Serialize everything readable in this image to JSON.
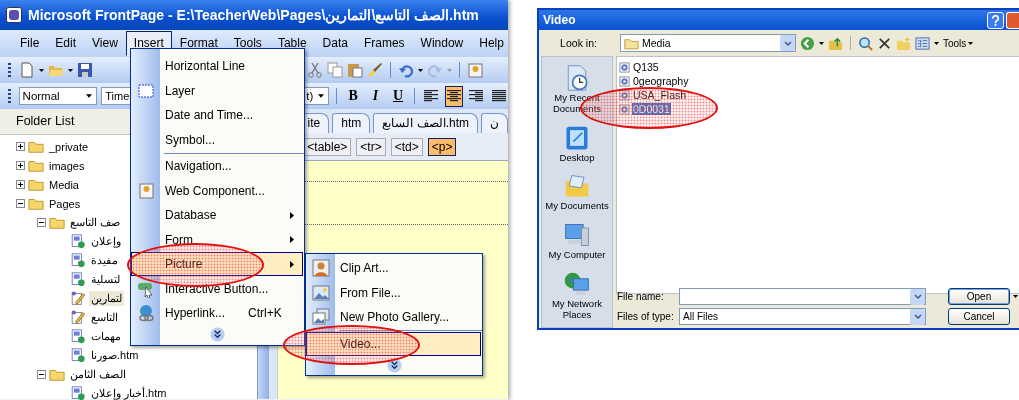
{
  "frontpage": {
    "title": "Microsoft FrontPage - E:\\TeacherWeb\\Pages\\الصف التاسع\\التمارين.htm",
    "menus": [
      {
        "label": "File",
        "selected": false
      },
      {
        "label": "Edit",
        "selected": false
      },
      {
        "label": "View",
        "selected": false
      },
      {
        "label": "Insert",
        "selected": true
      },
      {
        "label": "Format",
        "selected": false
      },
      {
        "label": "Tools",
        "selected": false
      },
      {
        "label": "Table",
        "selected": false
      },
      {
        "label": "Data",
        "selected": false
      },
      {
        "label": "Frames",
        "selected": false
      },
      {
        "label": "Window",
        "selected": false
      },
      {
        "label": "Help",
        "selected": false
      }
    ],
    "formatting": {
      "style": "Normal",
      "font": "Time",
      "size": "t)"
    },
    "text_buttons": [
      {
        "label": "B",
        "kind": "bold",
        "selected": false
      },
      {
        "label": "I",
        "kind": "italic",
        "selected": false
      },
      {
        "label": "U",
        "kind": "underline",
        "selected": false
      }
    ],
    "align_buttons": [
      {
        "kind": "left",
        "selected": false
      },
      {
        "kind": "center",
        "selected": true
      },
      {
        "kind": "right",
        "selected": false
      },
      {
        "kind": "justify",
        "selected": false
      }
    ],
    "folder_list": {
      "title": "Folder List",
      "items": [
        {
          "label": "_private",
          "kind": "folder",
          "expanded": false,
          "selected": false
        },
        {
          "label": "images",
          "kind": "folder",
          "expanded": false,
          "selected": false
        },
        {
          "label": "Media",
          "kind": "folder",
          "expanded": false,
          "selected": false
        },
        {
          "label": "Pages",
          "kind": "folder",
          "expanded": true,
          "selected": false,
          "children": [
            {
              "label": "صف التاسع",
              "kind": "folder",
              "expanded": true,
              "selected": false,
              "children": [
                {
                  "label": "وإعلان",
                  "kind": "page",
                  "selected": false
                },
                {
                  "label": "مفيدة",
                  "kind": "page",
                  "selected": false
                },
                {
                  "label": "لتسلية",
                  "kind": "page",
                  "selected": false
                },
                {
                  "label": "لتمارين",
                  "kind": "draft",
                  "selected": true
                },
                {
                  "label": "التاسع",
                  "kind": "draft",
                  "selected": false
                },
                {
                  "label": "مهمات",
                  "kind": "page",
                  "selected": false
                },
                {
                  "label": "صورنا.htm",
                  "kind": "page",
                  "selected": false
                }
              ]
            },
            {
              "label": "الصف الثامن",
              "kind": "folder",
              "expanded": true,
              "selected": false,
              "children": [
                {
                  "label": "أخبار وإعلان.htm",
                  "kind": "page",
                  "selected": false
                }
              ]
            }
          ]
        }
      ]
    },
    "page_tabs": [
      {
        "label": "ite"
      },
      {
        "label": "htm"
      },
      {
        "label": "الصف السابع.htm"
      },
      {
        "label": "ن"
      }
    ],
    "tag_path": [
      {
        "label": "<table>",
        "selected": false
      },
      {
        "label": "<tr>",
        "selected": false
      },
      {
        "label": "<td>",
        "selected": false
      },
      {
        "label": "<p>",
        "selected": true
      }
    ],
    "insert_menu": {
      "items": [
        {
          "kind": "item",
          "label": "Horizontal Line",
          "selected": false
        },
        {
          "kind": "item",
          "label": "Layer",
          "selected": false
        },
        {
          "kind": "item",
          "label": "Date and Time...",
          "selected": false
        },
        {
          "kind": "item",
          "label": "Symbol...",
          "selected": false
        },
        {
          "kind": "separator"
        },
        {
          "kind": "item",
          "label": "Navigation...",
          "selected": false
        },
        {
          "kind": "item",
          "label": "Web Component...",
          "selected": false
        },
        {
          "kind": "submenu",
          "label": "Database",
          "selected": false
        },
        {
          "kind": "submenu",
          "label": "Form",
          "selected": false
        },
        {
          "kind": "submenu",
          "label": "Picture",
          "selected": true
        },
        {
          "kind": "item",
          "label": "Interactive Button...",
          "selected": false
        },
        {
          "kind": "item",
          "label": "Hyperlink...",
          "shortcut": "Ctrl+K",
          "selected": false
        }
      ]
    },
    "picture_menu": {
      "items": [
        {
          "kind": "item",
          "label": "Clip Art...",
          "selected": false
        },
        {
          "kind": "item",
          "label": "From File...",
          "selected": false
        },
        {
          "kind": "item",
          "label": "New Photo Gallery...",
          "selected": false
        },
        {
          "kind": "separator"
        },
        {
          "kind": "item",
          "label": "Video...",
          "selected": true
        }
      ]
    }
  },
  "video_dialog": {
    "title": "Video",
    "look_in": {
      "label": "Look in:",
      "value": "Media"
    },
    "tools": "Tools",
    "places": [
      {
        "label": "My Recent Documents"
      },
      {
        "label": "Desktop"
      },
      {
        "label": "My Documents"
      },
      {
        "label": "My Computer"
      },
      {
        "label": "My Network Places"
      }
    ],
    "files": [
      {
        "name": "Q135",
        "selected": false
      },
      {
        "name": "0geography",
        "selected": false
      },
      {
        "name": "USA_Flash",
        "selected": false
      },
      {
        "name": "0D0031",
        "selected": true
      }
    ],
    "file_name": {
      "label": "File name:"
    },
    "file_type": {
      "label": "Files of type:",
      "value": "All Files"
    },
    "buttons": [
      "Open",
      "Cancel"
    ]
  }
}
